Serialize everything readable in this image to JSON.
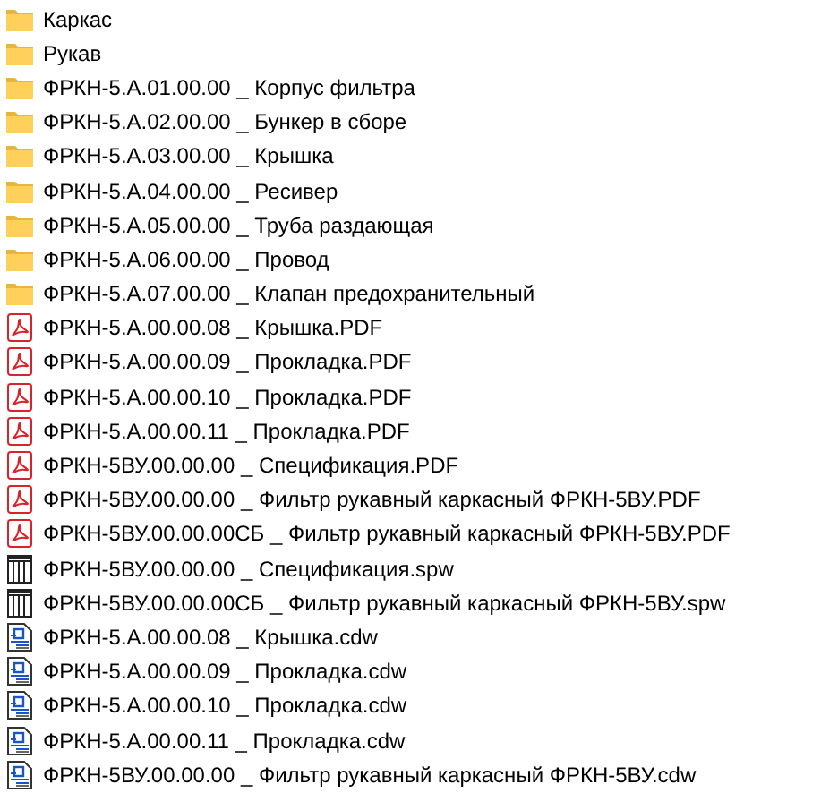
{
  "files": [
    {
      "kind": "folder",
      "name": "Каркас"
    },
    {
      "kind": "folder",
      "name": "Рукав"
    },
    {
      "kind": "folder",
      "name": "ФРКН-5.А.01.00.00 _ Корпус фильтра"
    },
    {
      "kind": "folder",
      "name": "ФРКН-5.А.02.00.00 _ Бункер в сборе"
    },
    {
      "kind": "folder",
      "name": "ФРКН-5.А.03.00.00 _ Крышка"
    },
    {
      "kind": "folder",
      "name": "ФРКН-5.А.04.00.00 _ Ресивер"
    },
    {
      "kind": "folder",
      "name": "ФРКН-5.А.05.00.00 _ Труба раздающая"
    },
    {
      "kind": "folder",
      "name": "ФРКН-5.А.06.00.00 _ Провод"
    },
    {
      "kind": "folder",
      "name": "ФРКН-5.А.07.00.00 _ Клапан предохранительный"
    },
    {
      "kind": "pdf",
      "name": "ФРКН-5.А.00.00.08 _ Крышка.PDF"
    },
    {
      "kind": "pdf",
      "name": "ФРКН-5.А.00.00.09 _ Прокладка.PDF"
    },
    {
      "kind": "pdf",
      "name": "ФРКН-5.А.00.00.10 _ Прокладка.PDF"
    },
    {
      "kind": "pdf",
      "name": "ФРКН-5.А.00.00.11 _ Прокладка.PDF"
    },
    {
      "kind": "pdf",
      "name": "ФРКН-5ВУ.00.00.00 _ Спецификация.PDF"
    },
    {
      "kind": "pdf",
      "name": "ФРКН-5ВУ.00.00.00 _ Фильтр рукавный каркасный ФРКН-5ВУ.PDF"
    },
    {
      "kind": "pdf",
      "name": "ФРКН-5ВУ.00.00.00СБ _ Фильтр рукавный каркасный ФРКН-5ВУ.PDF"
    },
    {
      "kind": "spw",
      "name": "ФРКН-5ВУ.00.00.00 _ Спецификация.spw"
    },
    {
      "kind": "spw",
      "name": "ФРКН-5ВУ.00.00.00СБ _ Фильтр рукавный каркасный ФРКН-5ВУ.spw"
    },
    {
      "kind": "cdw",
      "name": "ФРКН-5.А.00.00.08 _ Крышка.cdw"
    },
    {
      "kind": "cdw",
      "name": "ФРКН-5.А.00.00.09 _ Прокладка.cdw"
    },
    {
      "kind": "cdw",
      "name": "ФРКН-5.А.00.00.10 _ Прокладка.cdw"
    },
    {
      "kind": "cdw",
      "name": "ФРКН-5.А.00.00.11 _ Прокладка.cdw"
    },
    {
      "kind": "cdw",
      "name": "ФРКН-5ВУ.00.00.00 _ Фильтр рукавный каркасный ФРКН-5ВУ.cdw"
    }
  ]
}
